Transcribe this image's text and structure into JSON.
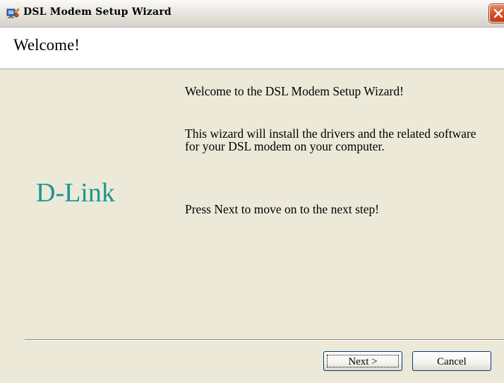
{
  "window": {
    "title": "DSL Modem Setup Wizard",
    "icon": "setup-wizard-icon"
  },
  "header": {
    "title": "Welcome!"
  },
  "brand": {
    "logo_text": "D-Link",
    "color": "#1a9792"
  },
  "content": {
    "paragraph1": "Welcome to the DSL Modem Setup Wizard!",
    "paragraph2": "This wizard will install the drivers and the related software for your DSL modem on your computer.",
    "paragraph3": "Press Next to move on to the next step!"
  },
  "buttons": {
    "next_label": "Next >",
    "cancel_label": "Cancel"
  },
  "colors": {
    "dialog_background": "#ece9d8",
    "header_background": "#ffffff",
    "close_button": "#d8512a"
  }
}
